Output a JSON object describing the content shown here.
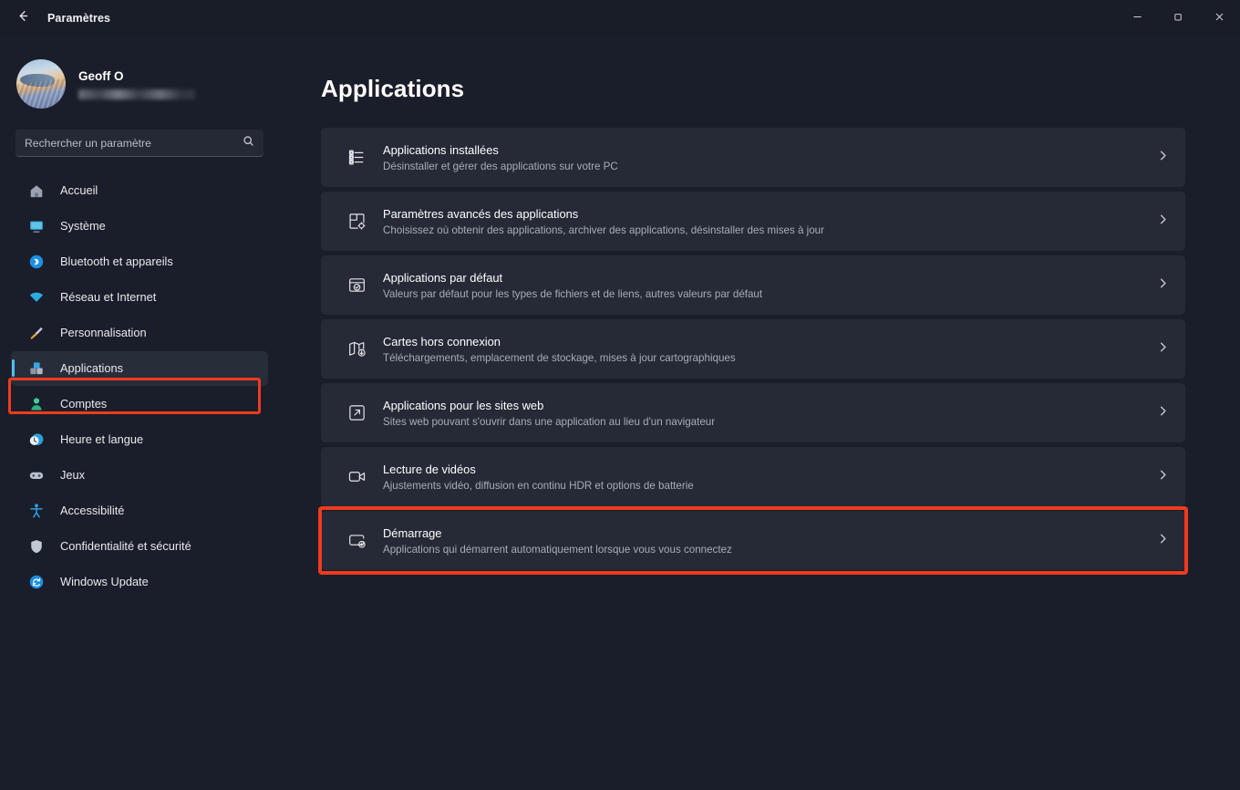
{
  "window": {
    "title": "Paramètres",
    "back_icon": "arrow-left-icon",
    "controls": {
      "minimize": "minimize-icon",
      "maximize": "maximize-icon",
      "close": "close-icon"
    }
  },
  "sidebar": {
    "profile": {
      "name": "Geoff O",
      "email_redacted": "",
      "avatar": "user-avatar-photo"
    },
    "search": {
      "placeholder": "Rechercher un paramètre",
      "value": "",
      "icon": "search-icon"
    },
    "items": [
      {
        "label": "Accueil",
        "icon": "home-icon",
        "selected": false
      },
      {
        "label": "Système",
        "icon": "display-icon",
        "selected": false
      },
      {
        "label": "Bluetooth et appareils",
        "icon": "bluetooth-icon",
        "selected": false
      },
      {
        "label": "Réseau et Internet",
        "icon": "wifi-icon",
        "selected": false
      },
      {
        "label": "Personnalisation",
        "icon": "paintbrush-icon",
        "selected": false
      },
      {
        "label": "Applications",
        "icon": "apps-icon",
        "selected": true
      },
      {
        "label": "Comptes",
        "icon": "person-icon",
        "selected": false
      },
      {
        "label": "Heure et langue",
        "icon": "clock-globe-icon",
        "selected": false
      },
      {
        "label": "Jeux",
        "icon": "gamepad-icon",
        "selected": false
      },
      {
        "label": "Accessibilité",
        "icon": "accessibility-icon",
        "selected": false
      },
      {
        "label": "Confidentialité et sécurité",
        "icon": "shield-icon",
        "selected": false
      },
      {
        "label": "Windows Update",
        "icon": "update-icon",
        "selected": false
      }
    ]
  },
  "main": {
    "title": "Applications",
    "rows": [
      {
        "title": "Applications installées",
        "subtitle": "Désinstaller et gérer des applications sur votre PC",
        "icon": "list-bullets-icon",
        "highlighted": false
      },
      {
        "title": "Paramètres avancés des applications",
        "subtitle": "Choisissez où obtenir des applications, archiver des applications, désinstaller des mises à jour",
        "icon": "app-settings-gear-icon",
        "highlighted": false
      },
      {
        "title": "Applications par défaut",
        "subtitle": "Valeurs par défaut pour les types de fichiers et de liens, autres valeurs par défaut",
        "icon": "window-check-icon",
        "highlighted": false
      },
      {
        "title": "Cartes hors connexion",
        "subtitle": "Téléchargements, emplacement de stockage, mises à jour cartographiques",
        "icon": "map-download-icon",
        "highlighted": false
      },
      {
        "title": "Applications pour les sites web",
        "subtitle": "Sites web pouvant s'ouvrir dans une application au lieu d'un navigateur",
        "icon": "external-link-icon",
        "highlighted": false
      },
      {
        "title": "Lecture de vidéos",
        "subtitle": "Ajustements vidéo, diffusion en continu HDR et options de batterie",
        "icon": "video-camera-icon",
        "highlighted": false
      },
      {
        "title": "Démarrage",
        "subtitle": "Applications qui démarrent automatiquement lorsque vous vous connectez",
        "icon": "startup-plus-icon",
        "highlighted": true
      }
    ],
    "chevron_icon": "chevron-right-icon"
  },
  "annotations": {
    "color": "#ef3b1f",
    "targets": [
      "sidebar-item-applications",
      "row-demarrage"
    ]
  }
}
